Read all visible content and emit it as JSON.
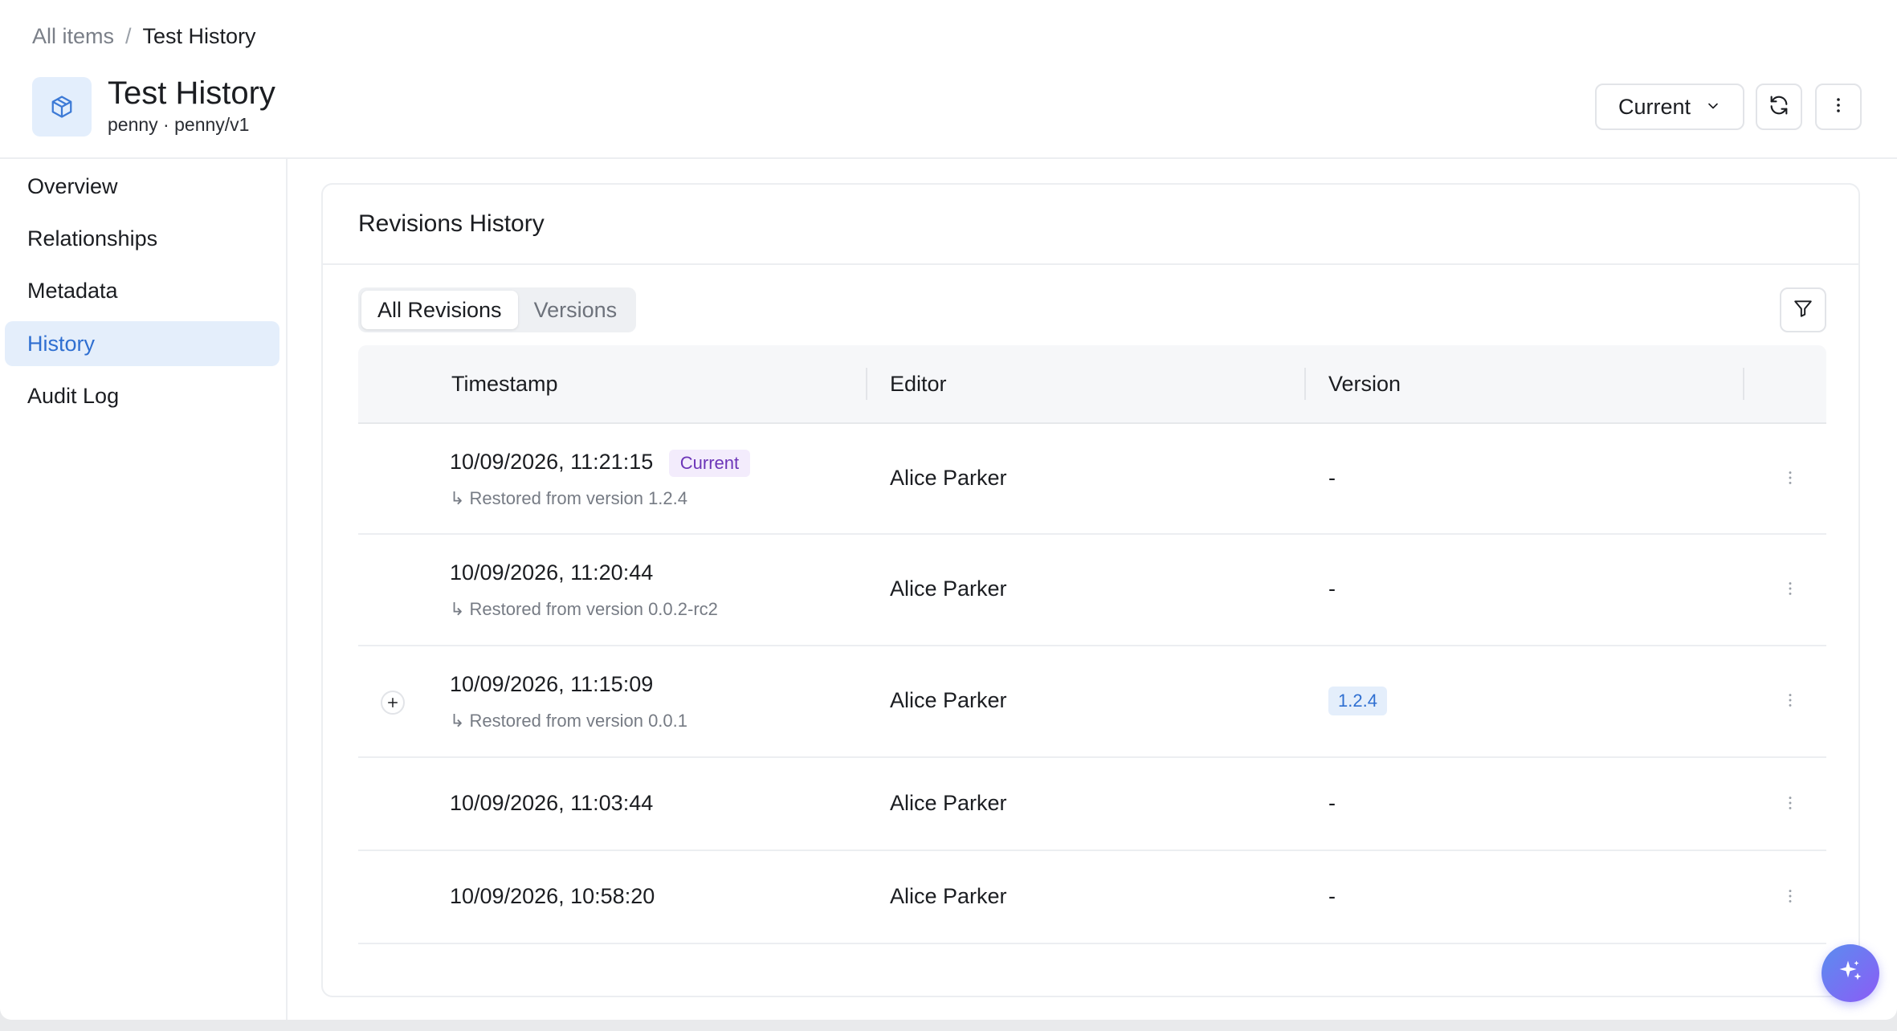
{
  "breadcrumb": {
    "root": "All items",
    "separator": "/",
    "current": "Test History"
  },
  "header": {
    "title": "Test History",
    "subtitle": "penny · penny/v1",
    "version_select": "Current"
  },
  "sidebar": {
    "items": [
      {
        "label": "Overview"
      },
      {
        "label": "Relationships"
      },
      {
        "label": "Metadata"
      },
      {
        "label": "History"
      },
      {
        "label": "Audit Log"
      }
    ],
    "active": "History"
  },
  "card": {
    "title": "Revisions History",
    "tabs": [
      {
        "label": "All Revisions"
      },
      {
        "label": "Versions"
      }
    ],
    "active_tab": "All Revisions"
  },
  "table": {
    "columns": [
      {
        "label": "Timestamp"
      },
      {
        "label": "Editor"
      },
      {
        "label": "Version"
      }
    ],
    "rows": [
      {
        "timestamp": "10/09/2026, 11:21:15",
        "badge": "Current",
        "note": "↳ Restored from version 1.2.4",
        "editor": "Alice Parker",
        "version": "-"
      },
      {
        "timestamp": "10/09/2026, 11:20:44",
        "note": "↳ Restored from version 0.0.2-rc2",
        "editor": "Alice Parker",
        "version": "-"
      },
      {
        "timestamp": "10/09/2026, 11:15:09",
        "note": "↳ Restored from version 0.0.1",
        "editor": "Alice Parker",
        "version": "1.2.4"
      },
      {
        "timestamp": "10/09/2026, 11:03:44",
        "editor": "Alice Parker",
        "version": "-"
      },
      {
        "timestamp": "10/09/2026, 10:58:20",
        "editor": "Alice Parker",
        "version": "-"
      }
    ]
  },
  "colors": {
    "accent": "#2f6fd1",
    "badge_purple": "#6c35b8",
    "fab_from": "#5b8def",
    "fab_to": "#8b5cf6"
  }
}
